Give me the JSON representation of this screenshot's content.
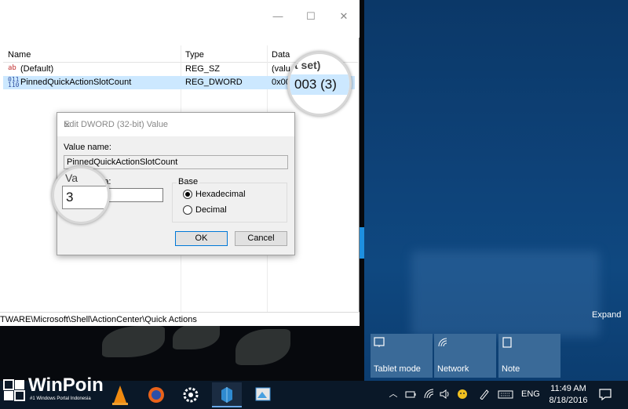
{
  "regedit": {
    "columns": [
      "Name",
      "Type",
      "Data"
    ],
    "rows": [
      {
        "icon": "ab",
        "name": "(Default)",
        "type": "REG_SZ",
        "data": "(valu"
      },
      {
        "icon": "011 110",
        "name": "PinnedQuickActionSlotCount",
        "type": "REG_DWORD",
        "data": "0x00"
      }
    ],
    "status_path": "TWARE\\Microsoft\\Shell\\ActionCenter\\Quick Actions",
    "window_buttons": {
      "minimize": "—",
      "maximize": "☐",
      "close": "✕"
    }
  },
  "magnifiers": {
    "data_zoom_top": "t set)",
    "data_zoom_value": "003 (3)",
    "value_zoom_label": "Va",
    "value_zoom_value": "3"
  },
  "dialog": {
    "title": "Edit DWORD (32-bit) Value",
    "close": "✕",
    "value_name_label": "Value name:",
    "value_name": "PinnedQuickActionSlotCount",
    "value_data_label": "data:",
    "value_data": "",
    "base_label": "Base",
    "radio_hex": "Hexadecimal",
    "radio_dec": "Decimal",
    "selected_base": "Hexadecimal",
    "ok": "OK",
    "cancel": "Cancel"
  },
  "action_center": {
    "expand": "Expand",
    "tiles": [
      {
        "label": "Tablet mode",
        "icon": "tablet-mode-icon"
      },
      {
        "label": "Network",
        "icon": "network-icon"
      },
      {
        "label": "Note",
        "icon": "note-icon"
      }
    ]
  },
  "taskbar": {
    "watermark_brand": "WinPoin",
    "watermark_tagline": "#1 Windows Portal Indonesia",
    "language": "ENG",
    "time": "11:49 AM",
    "date": "8/18/2016"
  }
}
